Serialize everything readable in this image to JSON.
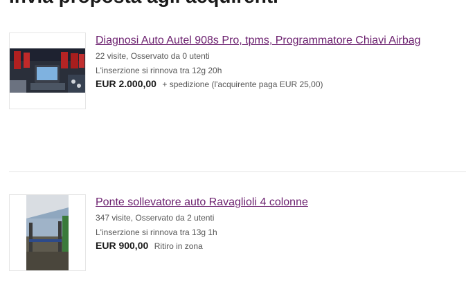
{
  "page": {
    "title": "Invia proposta agli acquirenti"
  },
  "listings": [
    {
      "title": "Diagnosi Auto Autel 908s Pro, tpms, Programmatore Chiavi Airbag",
      "stats": "22 visite, Osservato da 0 utenti",
      "renewal": "L'inserzione si rinnova tra 12g 20h",
      "price": "EUR 2.000,00",
      "shipping": "+ spedizione (l'acquirente paga EUR 25,00)"
    },
    {
      "title": "Ponte sollevatore auto Ravaglioli 4 colonne",
      "stats": "347 visite, Osservato da 2 utenti",
      "renewal": "L'inserzione si rinnova tra 13g 1h",
      "price": "EUR 900,00",
      "shipping": "Ritiro in zona"
    }
  ],
  "colors": {
    "link": "#6b1f6e",
    "text": "#191919",
    "muted": "#555555",
    "border": "#e5e5e5"
  }
}
